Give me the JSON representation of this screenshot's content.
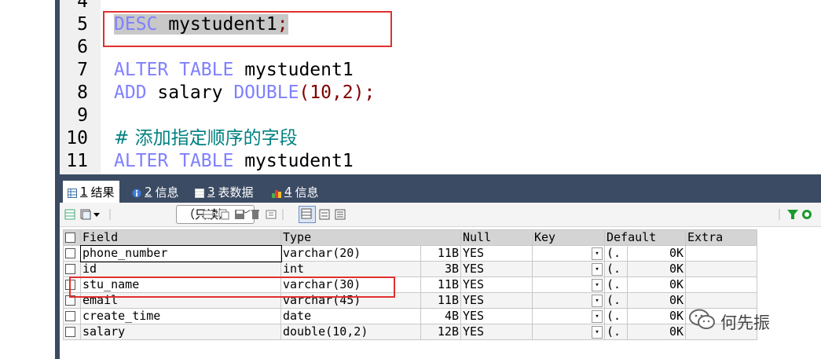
{
  "editor": {
    "lines": [
      {
        "num": "4"
      },
      {
        "num": "5",
        "kw": "DESC",
        "rest": " mystudent1",
        "punct": ";"
      },
      {
        "num": "6"
      },
      {
        "num": "7",
        "kw1": "ALTER",
        "kw2": "TABLE",
        "rest": " mystudent1"
      },
      {
        "num": "8",
        "kw1": "ADD",
        "mid": " salary ",
        "kw2": "DOUBLE",
        "args": "(10,2);"
      },
      {
        "num": "9"
      },
      {
        "num": "10",
        "comment": "# 添加指定顺序的字段"
      },
      {
        "num": "11",
        "kw1": "ALTER",
        "kw2": "TABLE",
        "rest": " mystudent1"
      }
    ]
  },
  "tabs": [
    {
      "num": "1",
      "label": "结果"
    },
    {
      "num": "2",
      "label": "信息"
    },
    {
      "num": "3",
      "label": "表数据"
    },
    {
      "num": "4",
      "label": "信息"
    }
  ],
  "toolbar": {
    "readonly": "（只读）"
  },
  "grid": {
    "columns": [
      "Field",
      "Type",
      "Null",
      "Key",
      "Default",
      "Extra"
    ],
    "rows": [
      {
        "field": "phone_number",
        "type": "varchar(20)",
        "size": "11B",
        "null": "YES",
        "default": "(.",
        "defsize": "0K"
      },
      {
        "field": "id",
        "type": "int",
        "size": "3B",
        "null": "YES",
        "default": "(.",
        "defsize": "0K"
      },
      {
        "field": "stu_name",
        "type": "varchar(30)",
        "size": "11B",
        "null": "YES",
        "default": "(.",
        "defsize": "0K"
      },
      {
        "field": "email",
        "type": "varchar(45)",
        "size": "11B",
        "null": "YES",
        "default": "(.",
        "defsize": "0K"
      },
      {
        "field": "create_time",
        "type": "date",
        "size": "4B",
        "null": "YES",
        "default": "(.",
        "defsize": "0K"
      },
      {
        "field": "salary",
        "type": "double(10,2)",
        "size": "12B",
        "null": "YES",
        "default": "(.",
        "defsize": "0K"
      }
    ]
  },
  "watermark": "何先振",
  "colors": {
    "keyword": "#8080ff",
    "comment": "#008080",
    "highlight": "#e03030",
    "tabbar": "#3b4b63"
  }
}
